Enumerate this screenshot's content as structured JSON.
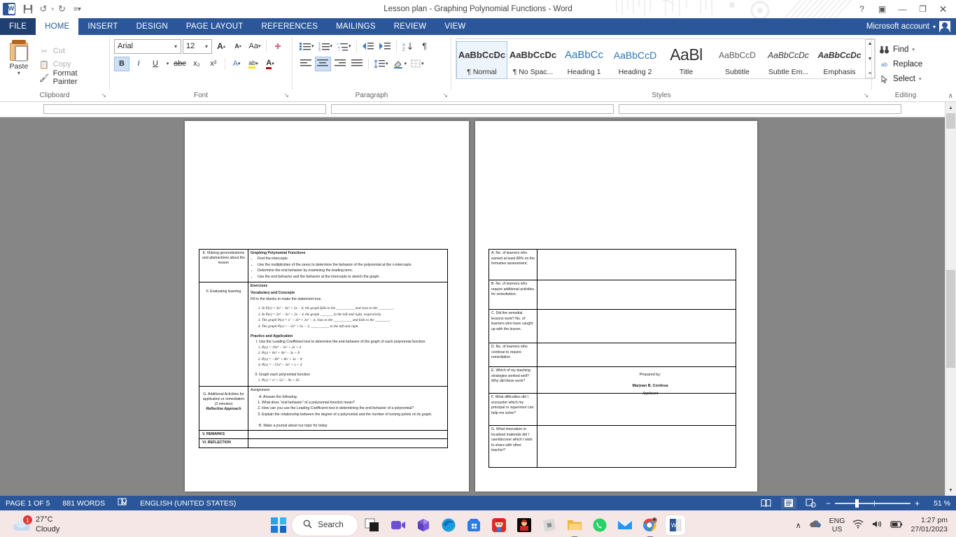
{
  "window": {
    "title": "Lesson plan - Graphing Polynomial Functions - Word",
    "quick_access": [
      {
        "name": "save-icon",
        "glyph": "💾"
      },
      {
        "name": "undo-icon",
        "glyph": "↶"
      },
      {
        "name": "redo-icon",
        "glyph": "↻"
      },
      {
        "name": "customize-qat-icon",
        "glyph": "≡"
      }
    ],
    "help_label": "?",
    "ribbon_display_label": "▣",
    "minimize_label": "—",
    "restore_label": "❐",
    "close_label": "✕",
    "account_label": "Microsoft account",
    "account_caret": "▾"
  },
  "ribbon": {
    "tabs": [
      {
        "label": "FILE",
        "active": false
      },
      {
        "label": "HOME",
        "active": true
      },
      {
        "label": "INSERT",
        "active": false
      },
      {
        "label": "DESIGN",
        "active": false
      },
      {
        "label": "PAGE LAYOUT",
        "active": false
      },
      {
        "label": "REFERENCES",
        "active": false
      },
      {
        "label": "MAILINGS",
        "active": false
      },
      {
        "label": "REVIEW",
        "active": false
      },
      {
        "label": "VIEW",
        "active": false
      }
    ],
    "clipboard": {
      "group_label": "Clipboard",
      "paste_label": "Paste",
      "cut_label": "Cut",
      "copy_label": "Copy",
      "format_painter_label": "Format Painter"
    },
    "font": {
      "group_label": "Font",
      "font_name": "Arial",
      "font_size": "12",
      "grow_label": "A",
      "shrink_label": "A",
      "change_case_label": "Aa",
      "clear_formatting_label": "✐",
      "bold_label": "B",
      "italic_label": "I",
      "underline_label": "U",
      "strikethrough_label": "abc",
      "subscript_label": "x₂",
      "superscript_label": "x²",
      "text_effects_label": "A",
      "highlight_label": "ab",
      "font_color_label": "A"
    },
    "paragraph": {
      "group_label": "Paragraph",
      "bullets_label": "•≡",
      "numbering_label": "1≡",
      "multilevel_label": "≡",
      "decrease_indent_label": "⇤",
      "increase_indent_label": "⇥",
      "sort_label": "A↓",
      "show_marks_label": "¶",
      "align_left_label": "≡",
      "align_center_label": "≡",
      "align_right_label": "≡",
      "justify_label": "≡",
      "line_spacing_label": "↕≡",
      "shading_label": "■",
      "borders_label": "▦"
    },
    "styles": {
      "group_label": "Styles",
      "items": [
        {
          "preview": "AaBbCcDc",
          "name": "¶ Normal",
          "selected": true,
          "color": "#333",
          "size": "13px",
          "style": "normal"
        },
        {
          "preview": "AaBbCcDc",
          "name": "¶ No Spac...",
          "selected": false,
          "color": "#333",
          "size": "13px",
          "style": "normal"
        },
        {
          "preview": "AaBbCc",
          "name": "Heading 1",
          "selected": false,
          "color": "#2e74b5",
          "size": "15px",
          "style": "normal"
        },
        {
          "preview": "AaBbCcD",
          "name": "Heading 2",
          "selected": false,
          "color": "#2e74b5",
          "size": "14px",
          "style": "normal"
        },
        {
          "preview": "AaBl",
          "name": "Title",
          "selected": false,
          "color": "#222",
          "size": "22px",
          "style": "normal"
        },
        {
          "preview": "AaBbCcD",
          "name": "Subtitle",
          "selected": false,
          "color": "#5a5a5a",
          "size": "12px",
          "style": "normal"
        },
        {
          "preview": "AaBbCcDc",
          "name": "Subtle Em...",
          "selected": false,
          "color": "#333",
          "size": "12px",
          "style": "italic"
        },
        {
          "preview": "AaBbCcDc",
          "name": "Emphasis",
          "selected": false,
          "color": "#333",
          "size": "12px",
          "style": "italic"
        }
      ],
      "scroll_up": "▲",
      "scroll_down": "▼",
      "more": "≡"
    },
    "editing": {
      "group_label": "Editing",
      "find_label": "Find",
      "replace_label": "Replace",
      "select_label": "Select",
      "find_icon": "🔍",
      "replace_icon": "ab",
      "select_icon": "↖"
    },
    "collapse_label": "∧",
    "dialog_launcher": "↘"
  },
  "document": {
    "left_page": {
      "rows": [
        {
          "label": "E. Making generalizations and abstractions about the lesson",
          "heading": "Graphing Polynomial Functions",
          "bullets": [
            "Find the intercepts.",
            "Use the multiplicities of the zeros to determine the behavior of the polynomial at the x-intercepts.",
            "Determine the end behavior by examining the leading term.",
            "Use the end behavior and the behavior at the intercepts to sketch the graph."
          ]
        },
        {
          "label": "F.   Evaluating learning",
          "exercises_heading": "Exercises",
          "vocab_heading": "Vocabulary and Concepts",
          "vocab_instruction": "Fill in the blanks to make the statement true.",
          "vocab_items": [
            "In P(x) = 3x³ − 4x² + 2x − 6, the graph falls to the __________ and rises to the ________.",
            "In P(x) = 2x⁶ − 3x² + 2x − 4, the graph _______ to the left and right, respectively.",
            "The graph P(x) = x⁷ − 3x⁴ + 3x² − 4, rises to the __________ and falls to the ________.",
            "The graph P(x) = −2x⁴ + 5x − 3, __________ to the left and right."
          ],
          "practice_heading": "Practice and Application",
          "practice_part_1_instruction": "Use the Leading Coefficient test to determine the end behavior of the graph of each polynomial function.",
          "practice_part_1_items": [
            "P(x) = 10x³ − 5x² + 2x + 4",
            "P(x) = 8x⁴ + 8x² − 3x + 8",
            "P(x) = −8x⁴ + 8x² + 3x − 8",
            "P(x) = −15x³ − 3x² + x + 4"
          ],
          "practice_part_2_instruction": "Graph each polynomial function",
          "practice_part_2_items": [
            "P(x) = x³ + 5x² − 9x + 45"
          ]
        },
        {
          "label": "G.  Additional Activities for application or remediation (3 minutes)",
          "label_italic": "Reflective Approach",
          "assignment_heading": "Assignment",
          "part_a_label": "A.  Answer the following:",
          "part_a_items": [
            "What does “end behavior” of a polynomial function mean?",
            "How can you use the Leading Coefficient test in determining the end behavior of a polynomial?",
            "Explain the relationship between the degree of a polynomial and the number of turning points on its graph."
          ],
          "part_b_label": "B.  Make a journal about our topic for today"
        },
        {
          "label": "V. REMARKS",
          "content": ""
        },
        {
          "label": "VI. REFLECTION",
          "content": ""
        }
      ]
    },
    "right_page": {
      "reflection_rows": [
        "A. No. of learners who earned at least 80% on the formative assessment.",
        "B. No. of learners who require additional activities for remediation.",
        "C. Did the remedial lessons work?  No. of learners who have caught up with the lesson.",
        "D. No. of learners who continue to require remediation",
        "E. Which of my teaching strategies worked well? Why did these work?",
        "F. What difficulties did I encounter which my principal or supervisor can help me solve?",
        "G. What innovation or localized materials did I use/discover which I wish to share with other teacher?"
      ],
      "prepared_by_label": "Prepared by:",
      "prepared_by_name": "Marjoan B. Cordova",
      "prepared_by_role": "Applicant"
    }
  },
  "statusbar": {
    "page_label": "PAGE 1 OF 5",
    "words_label": "881 WORDS",
    "proofing_icon": "📖",
    "language_label": "ENGLISH (UNITED STATES)",
    "view_read_icon": "📖",
    "view_print_icon": "▤",
    "view_web_icon": "🌐",
    "zoom_out_label": "−",
    "zoom_in_label": "+",
    "zoom_level": "51 %"
  },
  "taskbar": {
    "weather": {
      "badge": "1",
      "temperature": "27°C",
      "condition": "Cloudy"
    },
    "search_placeholder": "Search",
    "search_icon": "🔍",
    "apps": [
      {
        "name": "taskview-icon",
        "label": ""
      },
      {
        "name": "zoom-icon",
        "label": ""
      },
      {
        "name": "microsoft-365-icon",
        "label": ""
      },
      {
        "name": "edge-icon",
        "label": ""
      },
      {
        "name": "microsoft-store-icon",
        "label": ""
      },
      {
        "name": "game-icon",
        "label": ""
      },
      {
        "name": "mario-game-icon",
        "label": ""
      },
      {
        "name": "roblox-icon",
        "label": ""
      },
      {
        "name": "file-explorer-icon",
        "label": ""
      },
      {
        "name": "whatsapp-icon",
        "label": ""
      },
      {
        "name": "mail-icon",
        "label": ""
      },
      {
        "name": "chrome-icon",
        "label": ""
      },
      {
        "name": "word-icon",
        "label": ""
      }
    ],
    "tray": {
      "chevron": "∧",
      "onedrive_icon": "☁",
      "language_line1": "ENG",
      "language_line2": "US",
      "wifi_icon": "📶",
      "volume_icon": "🔊",
      "battery_icon": "🔋",
      "time": "1:27 pm",
      "date": "27/01/2023"
    }
  }
}
